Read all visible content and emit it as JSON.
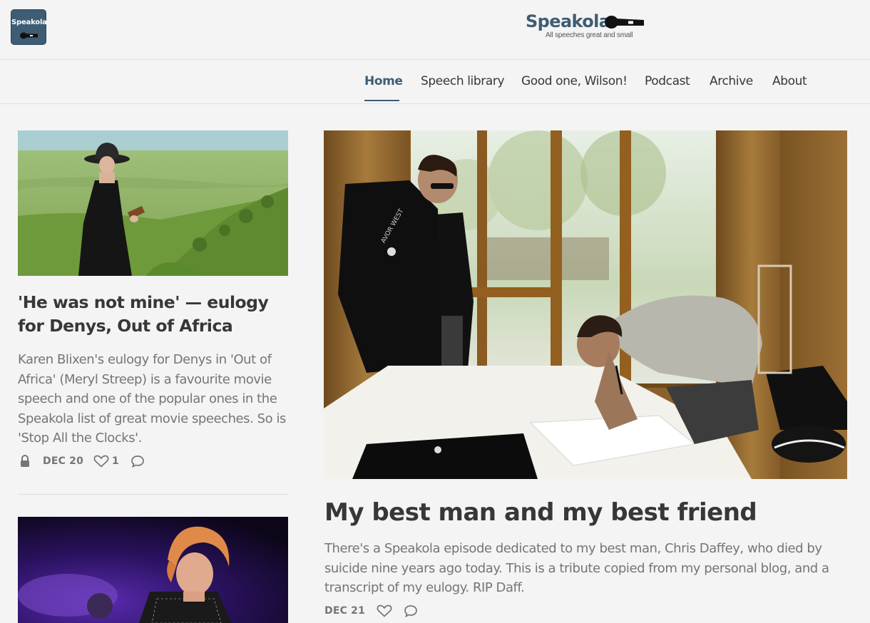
{
  "brand": {
    "icon_text": "Speakola",
    "name": "Speakola",
    "tagline": "All speeches great and small"
  },
  "nav": {
    "items": [
      {
        "label": "Home",
        "active": true
      },
      {
        "label": "Speech library"
      },
      {
        "label": "Good one, Wilson!"
      },
      {
        "label": "Podcast"
      },
      {
        "label": "Archive"
      },
      {
        "label": "About"
      }
    ]
  },
  "posts": {
    "left1": {
      "title": "'He was not mine' — eulogy for Denys, Out of Africa",
      "description": "Karen Blixen's eulogy for Denys in 'Out of Africa' (Meryl Streep) is a favourite movie speech and one of the popular ones in the Speakola list of great movie speeches. So is 'Stop All the Clocks'.",
      "date": "DEC 20",
      "likes": "1",
      "icons": [
        "lock-icon",
        "heart-icon",
        "comment-icon"
      ]
    },
    "featured": {
      "title": "My best man and my best friend",
      "description": "There's a Speakola episode dedicated to my best man, Chris Daffey, who died by suicide nine years ago today. This is a tribute copied from my personal blog, and a transcript of my eulogy. RIP Daff.",
      "date": "DEC 21",
      "icons": [
        "heart-icon",
        "comment-icon"
      ]
    }
  },
  "colors": {
    "accent": "#3e5d74",
    "background": "#f4f4f4",
    "text": "#363737",
    "muted": "#757575"
  }
}
